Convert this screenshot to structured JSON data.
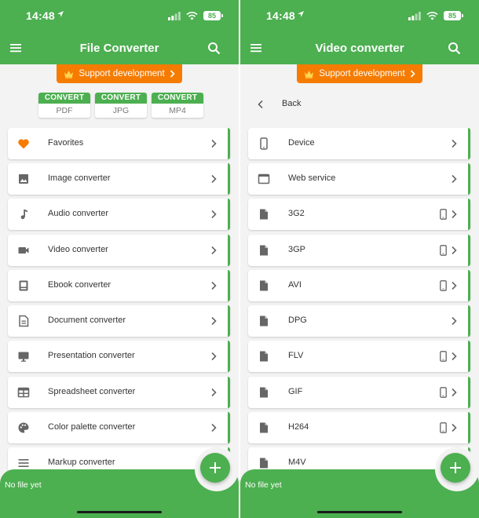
{
  "status_bar": {
    "time": "14:48",
    "battery": "85"
  },
  "left": {
    "title": "File Converter",
    "support_label": "Support development",
    "convert_to": [
      {
        "label": "CONVERT TO",
        "value": "PDF"
      },
      {
        "label": "CONVERT TO",
        "value": "JPG"
      },
      {
        "label": "CONVERT TO",
        "value": "MP4"
      }
    ],
    "items": [
      {
        "label": "Favorites",
        "icon": "heart-icon"
      },
      {
        "label": "Image converter",
        "icon": "image-icon"
      },
      {
        "label": "Audio converter",
        "icon": "music-note-icon"
      },
      {
        "label": "Video converter",
        "icon": "video-camera-icon"
      },
      {
        "label": "Ebook converter",
        "icon": "book-icon"
      },
      {
        "label": "Document converter",
        "icon": "document-icon"
      },
      {
        "label": "Presentation converter",
        "icon": "presentation-icon"
      },
      {
        "label": "Spreadsheet converter",
        "icon": "table-icon"
      },
      {
        "label": "Color palette converter",
        "icon": "palette-icon"
      },
      {
        "label": "Markup converter",
        "icon": "markup-icon"
      }
    ],
    "bottom_text": "No file yet"
  },
  "right": {
    "title": "Video converter",
    "support_label": "Support development",
    "back_label": "Back",
    "items": [
      {
        "label": "Device",
        "icon": "smartphone-icon",
        "device": false
      },
      {
        "label": "Web service",
        "icon": "browser-window-icon",
        "device": false
      },
      {
        "label": "3G2",
        "icon": "file-icon",
        "device": true
      },
      {
        "label": "3GP",
        "icon": "file-icon",
        "device": true
      },
      {
        "label": "AVI",
        "icon": "file-icon",
        "device": true
      },
      {
        "label": "DPG",
        "icon": "file-icon",
        "device": false
      },
      {
        "label": "FLV",
        "icon": "file-icon",
        "device": true
      },
      {
        "label": "GIF",
        "icon": "file-icon",
        "device": true
      },
      {
        "label": "H264",
        "icon": "file-icon",
        "device": true
      },
      {
        "label": "M4V",
        "icon": "file-icon",
        "device": true
      }
    ],
    "bottom_text": "No file yet"
  },
  "colors": {
    "primary": "#4caf50",
    "accent": "#f57c00",
    "heart": "#f57c00",
    "icon_grey": "#666666"
  }
}
